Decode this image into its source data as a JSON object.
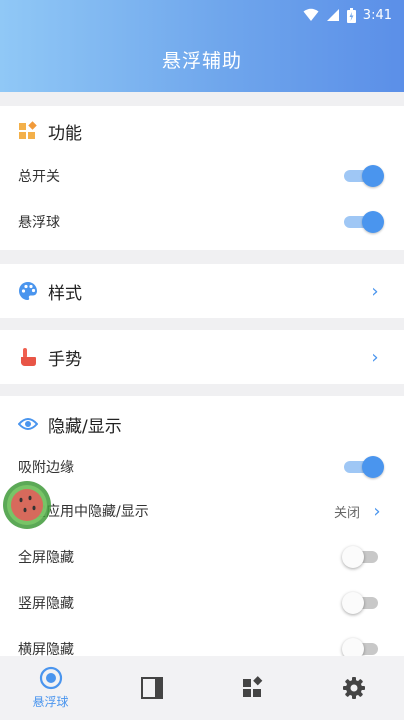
{
  "status_bar": {
    "time": "3:41"
  },
  "app": {
    "title": "悬浮辅助"
  },
  "sections": {
    "function": {
      "title": "功能",
      "rows": [
        {
          "label": "总开关",
          "on": true
        },
        {
          "label": "悬浮球",
          "on": true
        }
      ]
    },
    "style": {
      "title": "样式"
    },
    "gesture": {
      "title": "手势"
    },
    "visibility": {
      "title": "隐藏/显示",
      "rows": [
        {
          "label": "吸附边缘",
          "on": true
        },
        {
          "label": "指定应用中隐藏/显示",
          "value": "关闭"
        },
        {
          "label": "全屏隐藏",
          "on": false
        },
        {
          "label": "竖屏隐藏",
          "on": false
        },
        {
          "label": "横屏隐藏",
          "on": false
        }
      ]
    }
  },
  "bottom_nav": {
    "tabs": [
      {
        "label": "悬浮球",
        "icon": "target-icon",
        "active": true
      },
      {
        "label": "",
        "icon": "panel-icon"
      },
      {
        "label": "",
        "icon": "grid-icon"
      },
      {
        "label": "",
        "icon": "gear-icon"
      }
    ]
  },
  "colors": {
    "accent": "#4a95ee",
    "appbar_start": "#90c8f6",
    "appbar_end": "#5b8fe8"
  }
}
